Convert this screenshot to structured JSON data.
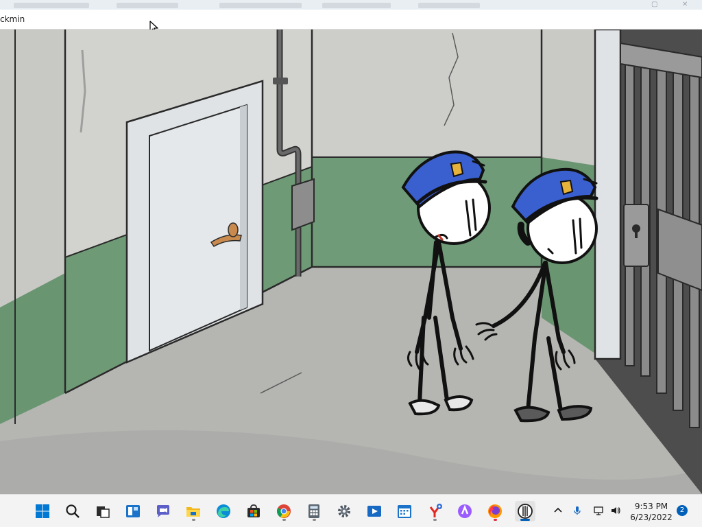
{
  "window": {
    "title": "ckmin"
  },
  "game": {
    "scene": "prison-corridor",
    "characters": [
      "guard-left",
      "guard-right"
    ],
    "colors": {
      "wall": "#cfcfcc",
      "wainscot": "#6e9a76",
      "floor": "#b3b3b0",
      "cap": "#3a5fcf",
      "badge": "#e6b23a",
      "door": "#dfe3e6",
      "handle": "#c98a4e"
    }
  },
  "taskbar": {
    "apps": [
      {
        "name": "start",
        "icon": "windows-logo-icon"
      },
      {
        "name": "search",
        "icon": "search-icon"
      },
      {
        "name": "task-view",
        "icon": "task-view-icon"
      },
      {
        "name": "widgets",
        "icon": "widgets-icon"
      },
      {
        "name": "teams-chat",
        "icon": "chat-icon"
      },
      {
        "name": "file-explorer",
        "icon": "folder-icon"
      },
      {
        "name": "edge",
        "icon": "edge-icon"
      },
      {
        "name": "store",
        "icon": "store-icon"
      },
      {
        "name": "chrome",
        "icon": "chrome-icon"
      },
      {
        "name": "calculator",
        "icon": "calculator-icon"
      },
      {
        "name": "settings",
        "icon": "gear-icon"
      },
      {
        "name": "movies-tv",
        "icon": "video-icon"
      },
      {
        "name": "calendar",
        "icon": "calendar-icon"
      },
      {
        "name": "yandex",
        "icon": "yandex-icon"
      },
      {
        "name": "alice",
        "icon": "assistant-icon"
      },
      {
        "name": "firefox",
        "icon": "firefox-icon"
      },
      {
        "name": "game-app",
        "icon": "stickman-app-icon"
      }
    ],
    "tray": {
      "icons": [
        "chevron-up-icon",
        "microphone-icon",
        "network-icon",
        "volume-icon"
      ],
      "time": "9:53 PM",
      "date": "6/23/2022",
      "notification_count": "2"
    }
  }
}
